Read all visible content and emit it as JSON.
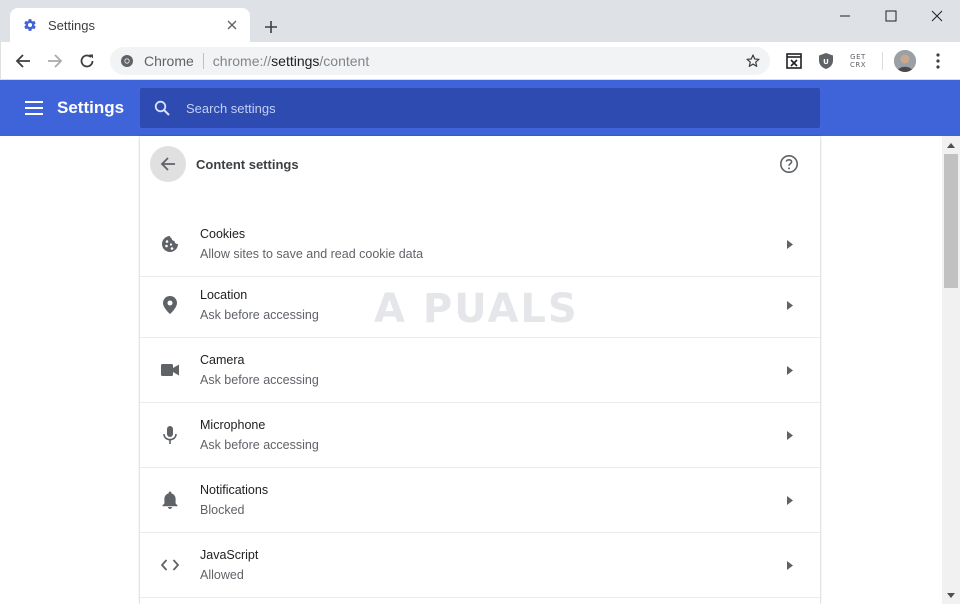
{
  "tab": {
    "title": "Settings",
    "icon": "gear-icon",
    "accent": "#3f63d8"
  },
  "toolbar": {
    "site_label": "Chrome",
    "url_scheme": "chrome://",
    "url_host": "settings",
    "url_path": "/content",
    "extension_crx_line1": "GET",
    "extension_crx_line2": "CRX"
  },
  "header": {
    "title": "Settings",
    "search_placeholder": "Search settings",
    "bar_color": "#3f63d8"
  },
  "content": {
    "title": "Content settings",
    "items": [
      {
        "label": "Cookies",
        "description": "Allow sites to save and read cookie data",
        "icon": "cookie-icon"
      },
      {
        "label": "Location",
        "description": "Ask before accessing",
        "icon": "location-pin-icon"
      },
      {
        "label": "Camera",
        "description": "Ask before accessing",
        "icon": "camera-icon"
      },
      {
        "label": "Microphone",
        "description": "Ask before accessing",
        "icon": "microphone-icon"
      },
      {
        "label": "Notifications",
        "description": "Blocked",
        "icon": "bell-icon"
      },
      {
        "label": "JavaScript",
        "description": "Allowed",
        "icon": "code-brackets-icon"
      }
    ]
  },
  "watermark": "A PUALS"
}
